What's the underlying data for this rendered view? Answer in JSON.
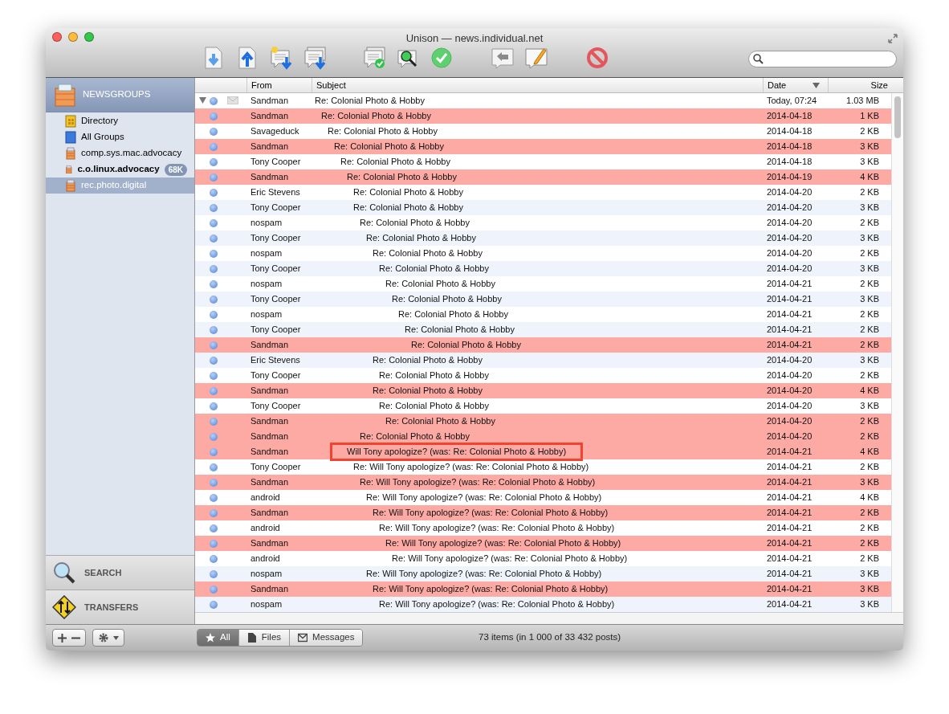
{
  "window": {
    "title": "Unison — news.individual.net"
  },
  "sidebar": {
    "header": "NEWSGROUPS",
    "items": [
      {
        "label": "Directory",
        "kind": "directory",
        "bold": false,
        "selected": false
      },
      {
        "label": "All Groups",
        "kind": "all",
        "bold": false,
        "selected": false
      },
      {
        "label": "comp.sys.mac.advocacy",
        "kind": "group",
        "bold": false,
        "selected": false
      },
      {
        "label": "c.o.linux.advocacy",
        "kind": "group",
        "bold": true,
        "badge": "68K",
        "selected": false
      },
      {
        "label": "rec.photo.digital",
        "kind": "group",
        "bold": false,
        "selected": true
      }
    ],
    "sections": [
      {
        "label": "SEARCH",
        "kind": "search"
      },
      {
        "label": "TRANSFERS",
        "kind": "transfers"
      }
    ]
  },
  "table": {
    "columns": [
      {
        "label": "From",
        "sorted": false
      },
      {
        "label": "Subject",
        "sorted": false
      },
      {
        "label": "Date",
        "sorted": true
      },
      {
        "label": "Size",
        "sorted": false
      }
    ],
    "threads": [
      {
        "from": "Sandman",
        "subject": "Re: Colonial Photo & Hobby",
        "date": "Today, 07:24",
        "size": "1.03 MB",
        "highlighted": false,
        "expanded": true,
        "envelope": true,
        "children": [
          {
            "from": "Sandman",
            "subject": "Re: Colonial Photo & Hobby",
            "date": "2014-04-18",
            "size": "1 KB",
            "highlighted": true,
            "children": [
              {
                "from": "Savageduck",
                "subject": "Re: Colonial Photo & Hobby",
                "date": "2014-04-18",
                "size": "2 KB",
                "highlighted": false,
                "children": [
                  {
                    "from": "Sandman",
                    "subject": "Re: Colonial Photo & Hobby",
                    "date": "2014-04-18",
                    "size": "3 KB",
                    "highlighted": true,
                    "children": [
                      {
                        "from": "Tony Cooper",
                        "subject": "Re: Colonial Photo & Hobby",
                        "date": "2014-04-18",
                        "size": "3 KB",
                        "highlighted": false,
                        "children": [
                          {
                            "from": "Sandman",
                            "subject": "Re: Colonial Photo & Hobby",
                            "date": "2014-04-19",
                            "size": "4 KB",
                            "highlighted": true,
                            "children": [
                              {
                                "from": "Eric Stevens",
                                "subject": "Re: Colonial Photo & Hobby",
                                "date": "2014-04-20",
                                "size": "2 KB",
                                "highlighted": false
                              },
                              {
                                "from": "Tony Cooper",
                                "subject": "Re: Colonial Photo & Hobby",
                                "date": "2014-04-20",
                                "size": "3 KB",
                                "highlighted": false,
                                "children": [
                                  {
                                    "from": "nospam",
                                    "subject": "Re: Colonial Photo & Hobby",
                                    "date": "2014-04-20",
                                    "size": "2 KB",
                                    "highlighted": false,
                                    "children": [
                                      {
                                        "from": "Tony Cooper",
                                        "subject": "Re: Colonial Photo & Hobby",
                                        "date": "2014-04-20",
                                        "size": "3 KB",
                                        "highlighted": false,
                                        "children": [
                                          {
                                            "from": "nospam",
                                            "subject": "Re: Colonial Photo & Hobby",
                                            "date": "2014-04-20",
                                            "size": "2 KB",
                                            "highlighted": false,
                                            "children": [
                                              {
                                                "from": "Tony Cooper",
                                                "subject": "Re: Colonial Photo & Hobby",
                                                "date": "2014-04-20",
                                                "size": "3 KB",
                                                "highlighted": false,
                                                "children": [
                                                  {
                                                    "from": "nospam",
                                                    "subject": "Re: Colonial Photo & Hobby",
                                                    "date": "2014-04-21",
                                                    "size": "2 KB",
                                                    "highlighted": false,
                                                    "children": [
                                                      {
                                                        "from": "Tony Cooper",
                                                        "subject": "Re: Colonial Photo & Hobby",
                                                        "date": "2014-04-21",
                                                        "size": "3 KB",
                                                        "highlighted": false,
                                                        "children": [
                                                          {
                                                            "from": "nospam",
                                                            "subject": "Re: Colonial Photo & Hobby",
                                                            "date": "2014-04-21",
                                                            "size": "2 KB",
                                                            "highlighted": false,
                                                            "children": [
                                                              {
                                                                "from": "Tony Cooper",
                                                                "subject": "Re: Colonial Photo & Hobby",
                                                                "date": "2014-04-21",
                                                                "size": "2 KB",
                                                                "highlighted": false,
                                                                "children": [
                                                                  {
                                                                    "from": "Sandman",
                                                                    "subject": "Re: Colonial Photo & Hobby",
                                                                    "date": "2014-04-21",
                                                                    "size": "2 KB",
                                                                    "highlighted": true
                                                                  }
                                                                ]
                                                              }
                                                            ]
                                                          }
                                                        ]
                                                      }
                                                    ]
                                                  }
                                                ]
                                              }
                                            ]
                                          },
                                          {
                                            "from": "Eric Stevens",
                                            "subject": "Re: Colonial Photo & Hobby",
                                            "date": "2014-04-20",
                                            "size": "3 KB",
                                            "highlighted": false,
                                            "children": [
                                              {
                                                "from": "Tony Cooper",
                                                "subject": "Re: Colonial Photo & Hobby",
                                                "date": "2014-04-20",
                                                "size": "2 KB",
                                                "highlighted": false
                                              }
                                            ]
                                          },
                                          {
                                            "from": "Sandman",
                                            "subject": "Re: Colonial Photo & Hobby",
                                            "date": "2014-04-20",
                                            "size": "4 KB",
                                            "highlighted": true,
                                            "children": [
                                              {
                                                "from": "Tony Cooper",
                                                "subject": "Re: Colonial Photo & Hobby",
                                                "date": "2014-04-20",
                                                "size": "3 KB",
                                                "highlighted": false,
                                                "children": [
                                                  {
                                                    "from": "Sandman",
                                                    "subject": "Re: Colonial Photo & Hobby",
                                                    "date": "2014-04-20",
                                                    "size": "2 KB",
                                                    "highlighted": true
                                                  }
                                                ]
                                              }
                                            ]
                                          }
                                        ]
                                      }
                                    ]
                                  },
                                  {
                                    "from": "Sandman",
                                    "subject": "Re: Colonial Photo & Hobby",
                                    "date": "2014-04-20",
                                    "size": "2 KB",
                                    "highlighted": true
                                  }
                                ]
                              }
                            ]
                          },
                          {
                            "from": "Sandman",
                            "subject": "Will Tony apologize? (was: Re: Colonial Photo & Hobby)",
                            "date": "2014-04-21",
                            "size": "4 KB",
                            "highlighted": true,
                            "callout": true,
                            "children": [
                              {
                                "from": "Tony Cooper",
                                "subject": "Re: Will Tony apologize? (was: Re: Colonial Photo & Hobby)",
                                "date": "2014-04-21",
                                "size": "2 KB",
                                "highlighted": false,
                                "children": [
                                  {
                                    "from": "Sandman",
                                    "subject": "Re: Will Tony apologize? (was: Re: Colonial Photo & Hobby)",
                                    "date": "2014-04-21",
                                    "size": "3 KB",
                                    "highlighted": true,
                                    "children": [
                                      {
                                        "from": "android",
                                        "subject": "Re: Will Tony apologize? (was: Re: Colonial Photo & Hobby)",
                                        "date": "2014-04-21",
                                        "size": "4 KB",
                                        "highlighted": false,
                                        "children": [
                                          {
                                            "from": "Sandman",
                                            "subject": "Re: Will Tony apologize? (was: Re: Colonial Photo & Hobby)",
                                            "date": "2014-04-21",
                                            "size": "2 KB",
                                            "highlighted": true,
                                            "children": [
                                              {
                                                "from": "android",
                                                "subject": "Re: Will Tony apologize? (was: Re: Colonial Photo & Hobby)",
                                                "date": "2014-04-21",
                                                "size": "2 KB",
                                                "highlighted": false,
                                                "children": [
                                                  {
                                                    "from": "Sandman",
                                                    "subject": "Re: Will Tony apologize? (was: Re: Colonial Photo & Hobby)",
                                                    "date": "2014-04-21",
                                                    "size": "2 KB",
                                                    "highlighted": true,
                                                    "children": [
                                                      {
                                                        "from": "android",
                                                        "subject": "Re: Will Tony apologize? (was: Re: Colonial Photo & Hobby)",
                                                        "date": "2014-04-21",
                                                        "size": "2 KB",
                                                        "highlighted": false
                                                      }
                                                    ]
                                                  }
                                                ]
                                              }
                                            ]
                                          }
                                        ]
                                      },
                                      {
                                        "from": "nospam",
                                        "subject": "Re: Will Tony apologize? (was: Re: Colonial Photo & Hobby)",
                                        "date": "2014-04-21",
                                        "size": "3 KB",
                                        "highlighted": false,
                                        "children": [
                                          {
                                            "from": "Sandman",
                                            "subject": "Re: Will Tony apologize? (was: Re: Colonial Photo & Hobby)",
                                            "date": "2014-04-21",
                                            "size": "3 KB",
                                            "highlighted": true,
                                            "children": [
                                              {
                                                "from": "nospam",
                                                "subject": "Re: Will Tony apologize? (was: Re: Colonial Photo & Hobby)",
                                                "date": "2014-04-21",
                                                "size": "3 KB",
                                                "highlighted": false
                                              }
                                            ]
                                          }
                                        ]
                                      }
                                    ]
                                  }
                                ]
                              }
                            ]
                          }
                        ]
                      }
                    ]
                  }
                ]
              }
            ]
          }
        ]
      }
    ]
  },
  "filter_tabs": [
    {
      "label": "All",
      "kind": "all",
      "selected": true
    },
    {
      "label": "Files",
      "kind": "files",
      "selected": false
    },
    {
      "label": "Messages",
      "kind": "messages",
      "selected": false
    }
  ],
  "status_bar": "73 items (in 1 000 of 33 432 posts)"
}
